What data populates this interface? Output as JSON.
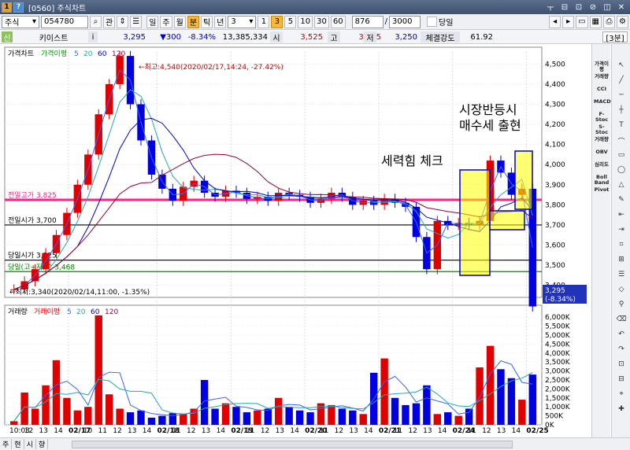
{
  "window": {
    "title": "[0560] 주식차트",
    "badge": "1",
    "help": "?",
    "controls": [
      "ㅜ",
      "⊟",
      "⊡",
      "⊘",
      "◫",
      "✕"
    ]
  },
  "toolbar": {
    "market": "주식",
    "code": "054780",
    "btn_gwan": "관",
    "periods": [
      "일",
      "주",
      "월",
      "분",
      "틱",
      "년"
    ],
    "active_period": "분",
    "interval": "3",
    "intervals": [
      "1",
      "3",
      "5",
      "10",
      "30",
      "60"
    ],
    "active_interval": "3",
    "count": "876",
    "total": "3000",
    "dangil_label": "당일"
  },
  "quote": {
    "badge": "신",
    "name": "키이스트",
    "info": "i",
    "price": "3,295",
    "change": "▼300",
    "change_pct": "-8.34%",
    "volume": "13,385,334",
    "open_label": "시",
    "open": "3,525",
    "high_label": "고",
    "high": "3,685",
    "low_label": "저",
    "low": "3,250",
    "strength_label": "체결강도",
    "strength": "61.92",
    "split": "[3분]"
  },
  "price_panel": {
    "legend": [
      {
        "text": "가격차트",
        "color": "#000000"
      },
      {
        "text": "가격이평",
        "color": "#009900"
      },
      {
        "text": "5",
        "color": "#3366ff"
      },
      {
        "text": "20",
        "color": "#22aaaa"
      },
      {
        "text": "60",
        "color": "#0000cc"
      },
      {
        "text": "120",
        "color": "#990033"
      }
    ],
    "hlines": [
      {
        "label": "전일고가 3,825",
        "value": 3825,
        "color": "#ff2288"
      },
      {
        "label": "전일시가 3,700",
        "value": 3700,
        "color": "#000000"
      },
      {
        "label": "당일시가 3,525",
        "value": 3525,
        "color": "#000000"
      },
      {
        "label": "당일(고+저)/2 3,468",
        "value": 3468,
        "color": "#008800"
      }
    ],
    "max_label": "←최고:4,540(2020/02/17,14:24, -27.42%)",
    "min_label": "←최저:3,340(2020/02/14,11:00, -1.35%)",
    "last_price": "3,295",
    "last_pct": "(-8.34%)"
  },
  "volume_panel": {
    "legend": [
      {
        "text": "거래량",
        "color": "#000000"
      },
      {
        "text": "거래이평",
        "color": "#ff0000"
      },
      {
        "text": "5",
        "color": "#3366ff"
      },
      {
        "text": "20",
        "color": "#22aaaa"
      },
      {
        "text": "60",
        "color": "#0000cc"
      },
      {
        "text": "120",
        "color": "#990033"
      }
    ]
  },
  "annotations": {
    "check": "세력힘 체크",
    "rebound_line1": "시장반등시",
    "rebound_line2": "매수세 출현"
  },
  "right_tools": [
    "가격이평",
    "거래량",
    "CCI",
    "MACD",
    "F-Stoc",
    "S-Stoc",
    "거래량",
    "OBV",
    "심리도",
    "Boll Band",
    "Pivot"
  ],
  "bottom_tabs": [
    "주",
    "현",
    "시",
    "향"
  ],
  "chart_data": [
    {
      "type": "candlestick",
      "y_ticks": [
        "4,500",
        "4,400",
        "4,300",
        "4,200",
        "4,100",
        "4,000",
        "3,900",
        "3,800",
        "3,700",
        "3,600",
        "3,500",
        "3,400"
      ],
      "ylim": [
        3340,
        4560
      ],
      "x_ticks": [
        "10:03",
        "12",
        "13",
        "14",
        "02/17",
        "10",
        "11",
        "12",
        "13",
        "14",
        "02/18",
        "11",
        "12",
        "13",
        "14",
        "02/19",
        "11",
        "12",
        "13",
        "14",
        "02/20",
        "11",
        "12",
        "13",
        "14",
        "02/21",
        "11",
        "12",
        "13",
        "14",
        "02/24",
        "11",
        "12",
        "13",
        "14",
        "02/25"
      ],
      "series": [
        {
          "name": "가격",
          "values": [
            3380,
            3420,
            3480,
            3560,
            3650,
            3760,
            3900,
            4050,
            4250,
            4400,
            4540,
            4300,
            4120,
            3950,
            3880,
            3820,
            3890,
            3920,
            3860,
            3840,
            3870,
            3860,
            3830,
            3840,
            3820,
            3860,
            3850,
            3840,
            3810,
            3830,
            3860,
            3840,
            3800,
            3820,
            3800,
            3830,
            3810,
            3790,
            3640,
            3480,
            3720,
            3700,
            3710,
            3700,
            3720,
            4020,
            3960,
            3850,
            3880,
            3295
          ]
        }
      ]
    },
    {
      "type": "bar",
      "y_ticks": [
        "6,000K",
        "5,500K",
        "5,000K",
        "4,500K",
        "4,000K",
        "3,500K",
        "3,000K",
        "2,500K",
        "2,000K",
        "1,500K",
        "1,000K",
        "500K",
        "0K"
      ],
      "ylim": [
        0,
        6400
      ],
      "series": [
        {
          "name": "거래량",
          "values": [
            200,
            1800,
            900,
            2200,
            3600,
            1500,
            800,
            1000,
            6100,
            1700,
            900,
            700,
            800,
            400,
            500,
            650,
            600,
            900,
            2500,
            900,
            1200,
            1000,
            700,
            800,
            900,
            1500,
            1000,
            800,
            700,
            1200,
            1100,
            900,
            800,
            600,
            2900,
            3700,
            1500,
            1100,
            1200,
            2200,
            600,
            700,
            500,
            900,
            3200,
            4400,
            3100,
            2600,
            1400,
            2800
          ]
        }
      ]
    }
  ]
}
